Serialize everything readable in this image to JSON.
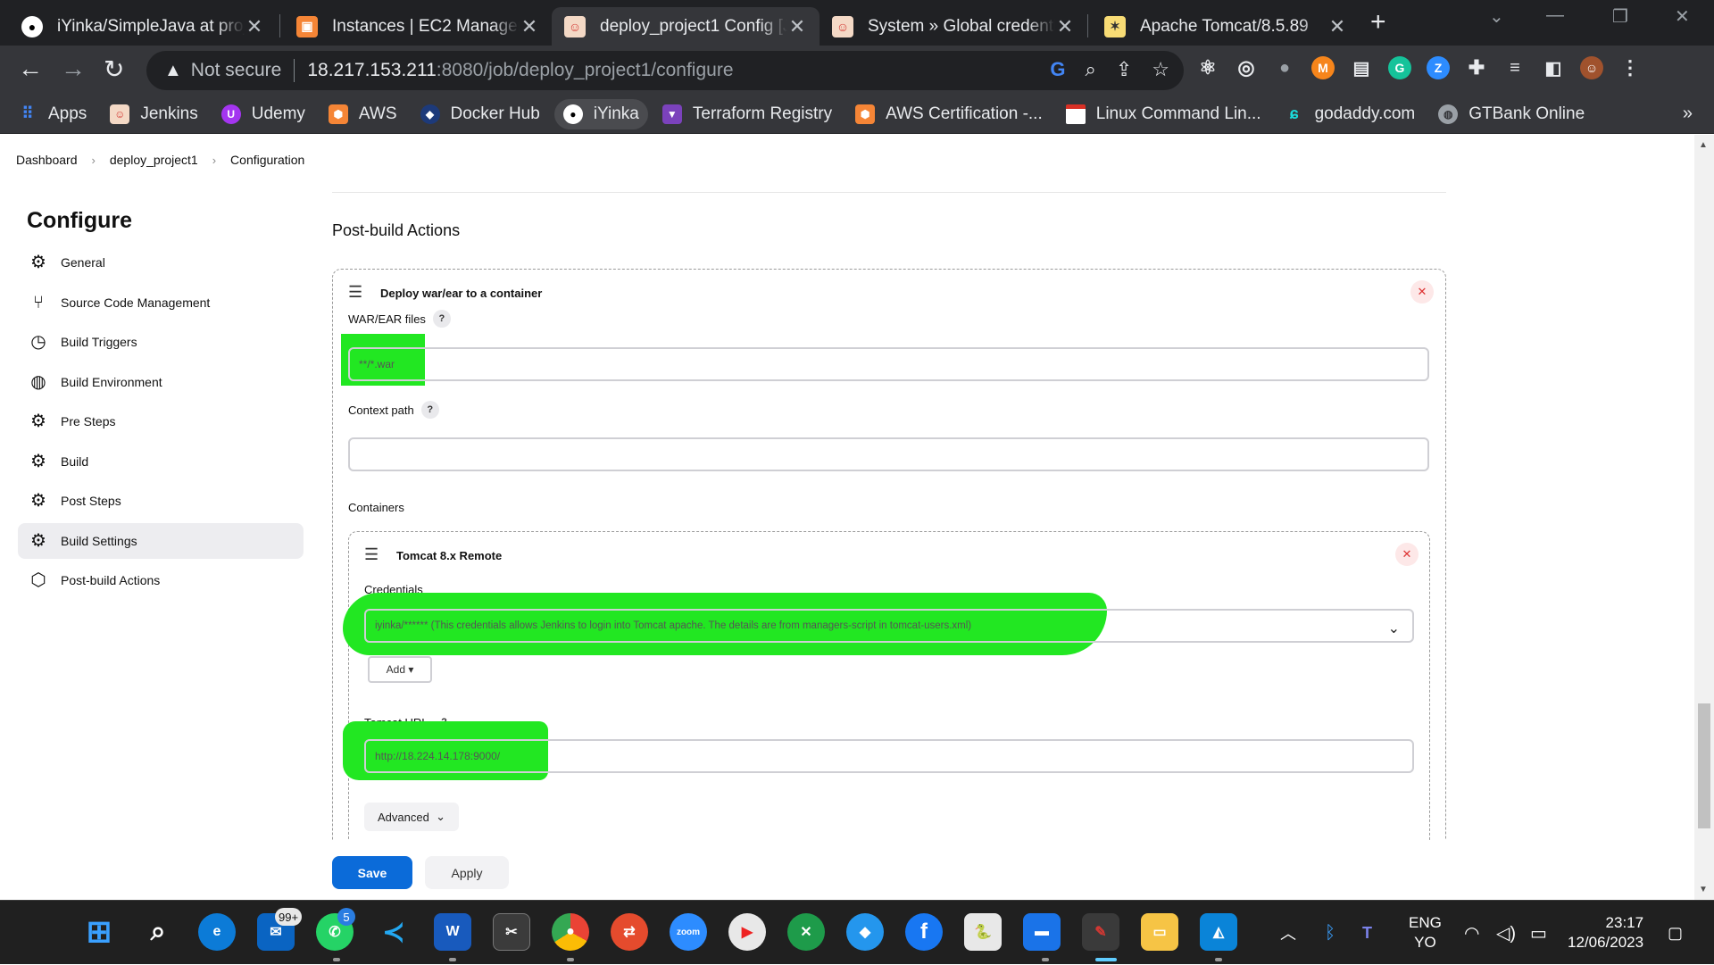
{
  "browser": {
    "tabs": [
      {
        "title": "iYinka/SimpleJava at proje",
        "icon": "github-icon",
        "color": "#ffffff"
      },
      {
        "title": "Instances | EC2 Managem",
        "icon": "aws-ec2-icon",
        "color": "#f58536"
      },
      {
        "title": "deploy_project1 Config [J",
        "icon": "jenkins-icon",
        "color": "#d33833"
      },
      {
        "title": "System » Global credentia",
        "icon": "jenkins-icon",
        "color": "#d33833"
      },
      {
        "title": "Apache Tomcat/8.5.89",
        "icon": "tomcat-icon",
        "color": "#f8dc75"
      }
    ],
    "active_tab": 2,
    "address": {
      "security_label": "Not secure",
      "host": "18.217.153.211",
      "path": ":8080/job/deploy_project1/configure"
    },
    "bookmarks": [
      {
        "label": "Apps",
        "icon": "apps-grid-icon",
        "color": "#4285f4"
      },
      {
        "label": "Jenkins",
        "icon": "jenkins-icon",
        "color": "#d33833"
      },
      {
        "label": "Udemy",
        "icon": "udemy-icon",
        "color": "#a435f0"
      },
      {
        "label": "AWS",
        "icon": "aws-icon",
        "color": "#f58536"
      },
      {
        "label": "Docker Hub",
        "icon": "docker-icon",
        "color": "#1d63ed"
      },
      {
        "label": "iYinka",
        "icon": "github-icon",
        "color": "#ffffff"
      },
      {
        "label": "Terraform Registry",
        "icon": "terraform-icon",
        "color": "#7b42bc"
      },
      {
        "label": "AWS Certification -...",
        "icon": "aws-icon",
        "color": "#f58536"
      },
      {
        "label": "Linux Command Lin...",
        "icon": "page-icon",
        "color": "#d93025"
      },
      {
        "label": "godaddy.com",
        "icon": "godaddy-icon",
        "color": "#1bdbdb"
      },
      {
        "label": "GTBank Online",
        "icon": "globe-icon",
        "color": "#9aa0a6"
      }
    ]
  },
  "jenkins": {
    "breadcrumb": [
      "Dashboard",
      "deploy_project1",
      "Configuration"
    ],
    "page_title": "Configure",
    "nav": [
      {
        "label": "General",
        "icon": "gear-icon"
      },
      {
        "label": "Source Code Management",
        "icon": "branch-icon"
      },
      {
        "label": "Build Triggers",
        "icon": "clock-icon"
      },
      {
        "label": "Build Environment",
        "icon": "globe-icon"
      },
      {
        "label": "Pre Steps",
        "icon": "gear-icon"
      },
      {
        "label": "Build",
        "icon": "gear-icon"
      },
      {
        "label": "Post Steps",
        "icon": "gear-icon"
      },
      {
        "label": "Build Settings",
        "icon": "gear-icon"
      },
      {
        "label": "Post-build Actions",
        "icon": "cube-icon"
      }
    ],
    "active_nav": 7,
    "section_title": "Post-build Actions",
    "deploy_step": {
      "title": "Deploy war/ear to a container",
      "war_label": "WAR/EAR files",
      "war_value": "**/*.war",
      "context_label": "Context path",
      "context_value": "",
      "containers_label": "Containers",
      "container": {
        "title": "Tomcat 8.x Remote",
        "credentials_label": "Credentials",
        "credentials_value": "iyinka/****** (This credentials allows Jenkins to login into Tomcat apache. The details are from managers-script in tomcat-users.xml)",
        "add_label": "Add",
        "url_label": "Tomcat URL",
        "url_value": "http://18.224.14.178:9000/",
        "advanced_label": "Advanced"
      }
    },
    "save_label": "Save",
    "apply_label": "Apply",
    "help_glyph": "?",
    "highlight_color": "#22e722"
  },
  "taskbar": {
    "mail_badge": "99+",
    "whatsapp_badge": "5",
    "language": "ENG",
    "input_method": "YO",
    "time": "23:17",
    "date": "12/06/2023"
  }
}
